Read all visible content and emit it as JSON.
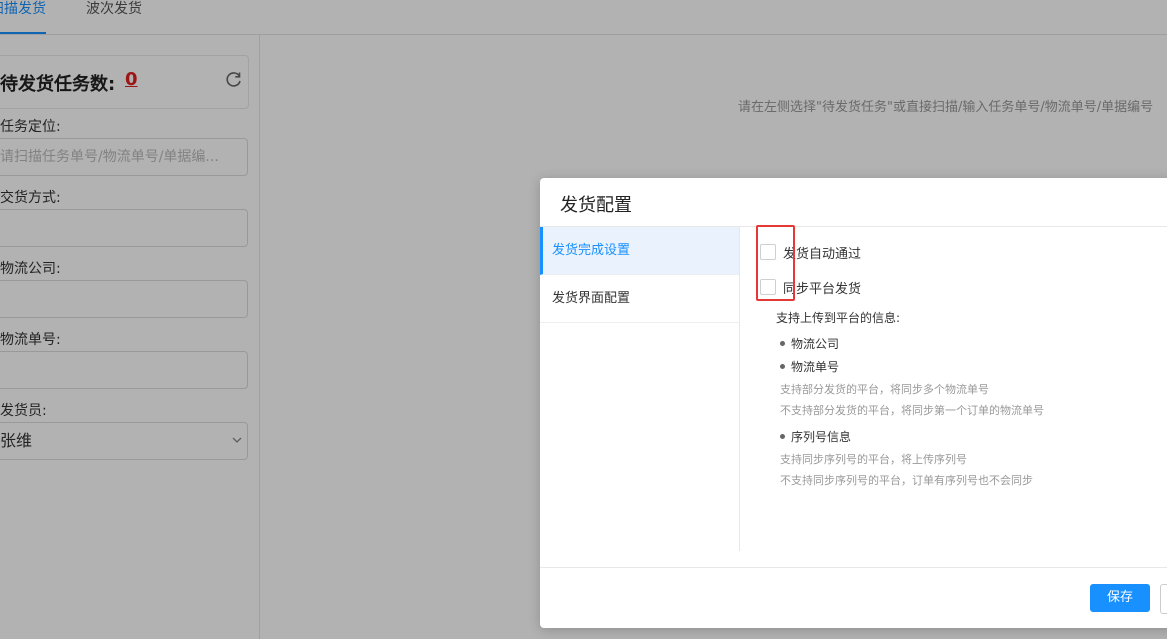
{
  "tabs": {
    "scan": "扫描发货",
    "wave": "波次发货"
  },
  "left_panel": {
    "task_title": "待发货任务数:",
    "task_count": "0",
    "locate_label": "任务定位:",
    "locate_placeholder": "请扫描任务单号/物流单号/单据编...",
    "delivery_method_label": "交货方式:",
    "logistics_company_label": "物流公司:",
    "tracking_no_label": "物流单号:",
    "shipper_label": "发货员:",
    "shipper_value": "张维"
  },
  "hint": "请在左侧选择\"待发货任务\"或直接扫描/输入任务单号/物流单号/单据编号",
  "modal": {
    "title": "发货配置",
    "menu": [
      "发货完成设置",
      "发货界面配置"
    ],
    "checkboxes": [
      {
        "label": "发货自动通过",
        "checked": false
      },
      {
        "label": "同步平台发货",
        "checked": false
      }
    ],
    "support_title": "支持上传到平台的信息:",
    "item_company": "物流公司",
    "item_tracking": "物流单号",
    "tracking_note_1": "支持部分发货的平台，将同步多个物流单号",
    "tracking_note_2": "不支持部分发货的平台，将同步第一个订单的物流单号",
    "item_serial": "序列号信息",
    "serial_note_1": "支持同步序列号的平台，将上传序列号",
    "serial_note_2": "不支持同步序列号的平台，订单有序列号也不会同步",
    "save_label": "保存"
  },
  "colors": {
    "accent": "#1890ff",
    "count": "#e02020",
    "highlight_box": "#e53935"
  }
}
